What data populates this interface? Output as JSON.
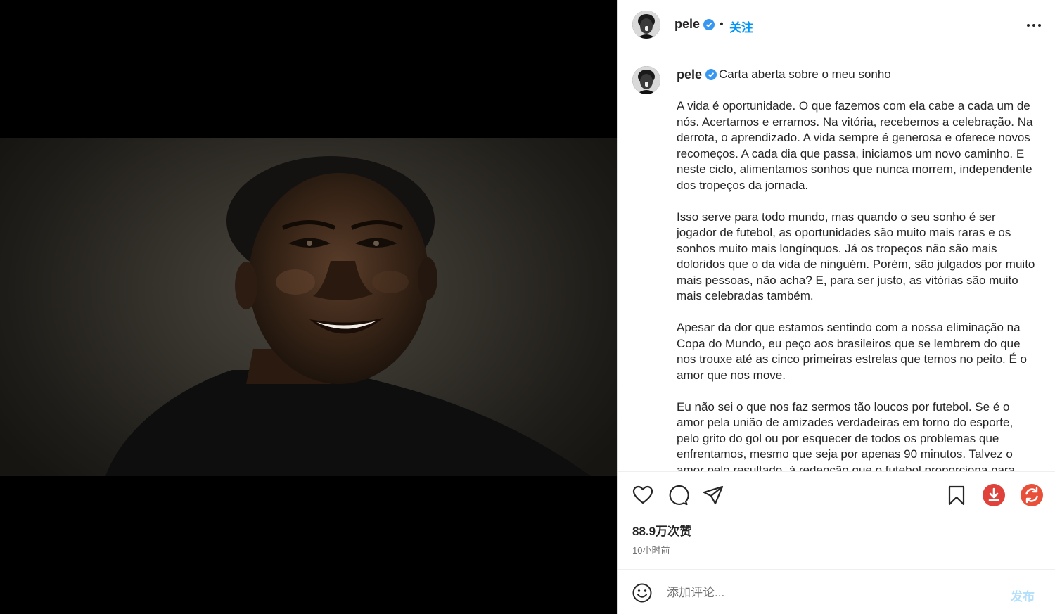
{
  "post": {
    "header": {
      "username": "pele",
      "separator": "•",
      "follow_label": "关注"
    },
    "caption": {
      "username": "pele",
      "title": "Carta aberta sobre o meu sonho",
      "body": "A vida é oportunidade. O que fazemos com ela cabe a cada um de nós. Acertamos e erramos. Na vitória, recebemos a celebração. Na derrota, o aprendizado. A vida sempre é generosa e oferece novos recomeços. A cada dia que passa, iniciamos um novo caminho. E neste ciclo, alimentamos sonhos que nunca morrem, independente dos tropeços da jornada.\n\nIsso serve para todo mundo, mas quando o seu sonho é ser jogador de futebol, as oportunidades são muito mais raras e os sonhos muito mais longínquos. Já os tropeços não são mais doloridos que o da vida de ninguém. Porém, são julgados por muito mais pessoas, não acha? E, para ser justo, as vitórias são muito mais celebradas também.\n\nApesar da dor que estamos sentindo com a nossa eliminação na Copa do Mundo, eu peço aos brasileiros que se lembrem do que nos trouxe até as cinco primeiras estrelas que temos no peito. É o amor que nos move.\n\nEu não sei o que nos faz sermos tão loucos por futebol. Se é o amor pela união de amizades verdadeiras em torno do esporte, pelo grito do gol ou por esquecer de todos os problemas que enfrentamos, mesmo que seja por apenas 90 minutos. Talvez o amor pelo resultado, à redenção que o futebol proporciona para aqueles que sonham com a vitória. Talvez o amor pela camisa."
    },
    "likes": "88.9万次赞",
    "timestamp": "10小时前"
  },
  "comment": {
    "placeholder": "添加评论...",
    "post_label": "发布"
  },
  "icons": {
    "like": "heart-icon",
    "comment": "comment-icon",
    "share": "share-icon",
    "save": "bookmark-icon",
    "download": "download-icon",
    "refresh": "refresh-icon",
    "more": "more-icon",
    "emoji": "emoji-icon",
    "verified": "verified-badge-icon"
  },
  "colors": {
    "accent": "#0095f6",
    "post_disabled": "#b2dffc",
    "download_btn": "#e0413a",
    "refresh_btn": "#e8503a",
    "verified": "#3897f0"
  }
}
